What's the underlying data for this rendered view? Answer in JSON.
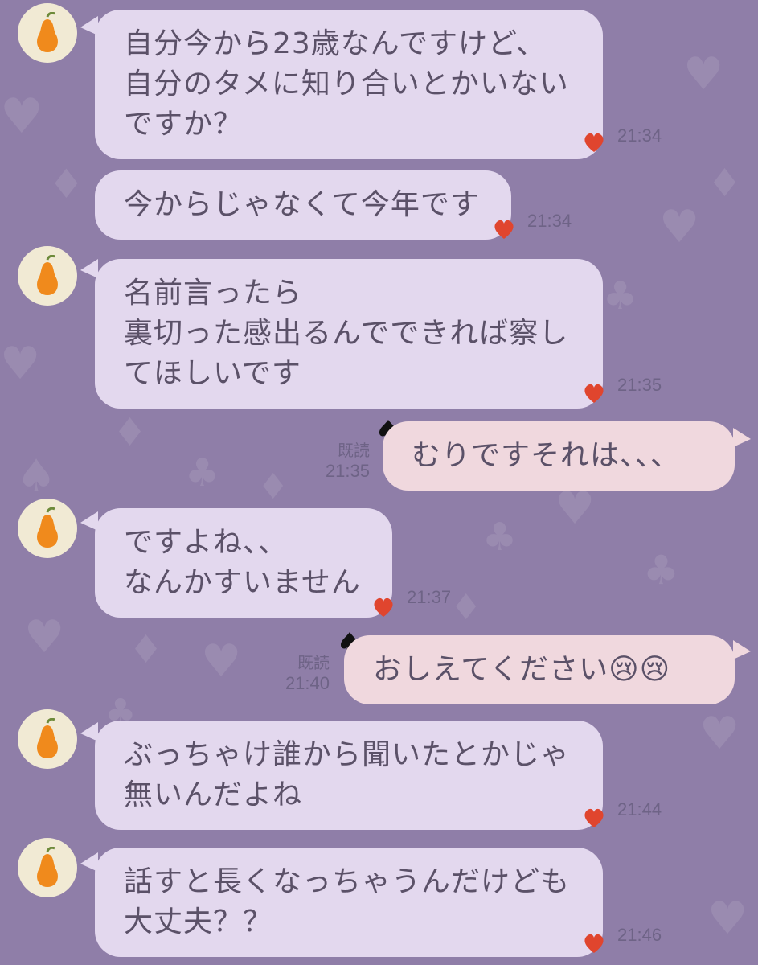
{
  "chat": {
    "messages": [
      {
        "side": "in",
        "text": "自分今から23歳なんですけど、\n自分のタメに知り合いとかいない\nですか？",
        "time": "21:34"
      },
      {
        "side": "in",
        "text": "今からじゃなくて今年です",
        "time": "21:34"
      },
      {
        "side": "in",
        "text": "名前言ったら\n裏切った感出るんでできれば察し\nてほしいです",
        "time": "21:35"
      },
      {
        "side": "out",
        "text": "むりですそれは、、、",
        "read": "既読",
        "time": "21:35"
      },
      {
        "side": "in",
        "text": "ですよね、、\nなんかすいません",
        "time": "21:37"
      },
      {
        "side": "out",
        "text": "おしえてください😢😢",
        "read": "既読",
        "time": "21:40"
      },
      {
        "side": "in",
        "text": "ぶっちゃけ誰から聞いたとかじゃ\n無いんだよね",
        "time": "21:44"
      },
      {
        "side": "in",
        "text": "話すと長くなっちゃうんだけども\n大丈夫？？",
        "time": "21:46"
      }
    ]
  },
  "icons": {
    "avatar": "pear-icon",
    "reaction": "heart-icon",
    "read_marker": "spade-icon"
  },
  "colors": {
    "background": "#8f7ea8",
    "incoming_bubble": "#e3d8ee",
    "outgoing_bubble": "#f0d8de",
    "pear": "#f08a1c",
    "heart": "#e0452e"
  }
}
